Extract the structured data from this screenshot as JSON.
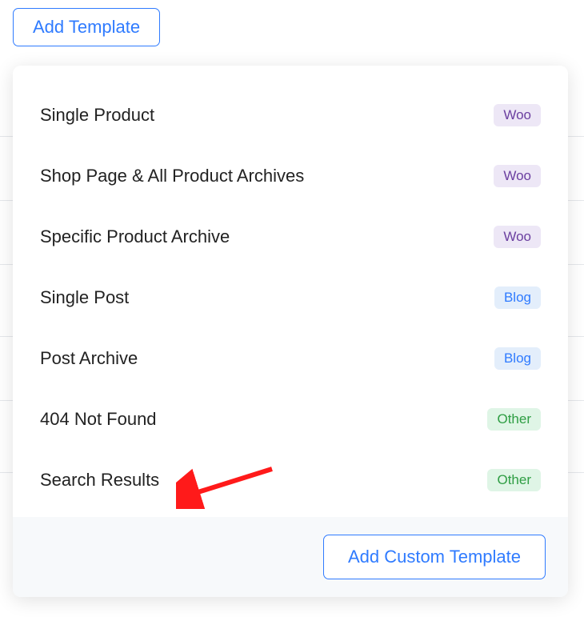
{
  "trigger": {
    "label": "Add Template"
  },
  "items": [
    {
      "label": "Single Product",
      "badge": "Woo",
      "badgeClass": "badge-woo"
    },
    {
      "label": "Shop Page & All Product Archives",
      "badge": "Woo",
      "badgeClass": "badge-woo"
    },
    {
      "label": "Specific Product Archive",
      "badge": "Woo",
      "badgeClass": "badge-woo"
    },
    {
      "label": "Single Post",
      "badge": "Blog",
      "badgeClass": "badge-blog"
    },
    {
      "label": "Post Archive",
      "badge": "Blog",
      "badgeClass": "badge-blog"
    },
    {
      "label": "404 Not Found",
      "badge": "Other",
      "badgeClass": "badge-other"
    },
    {
      "label": "Search Results",
      "badge": "Other",
      "badgeClass": "badge-other"
    }
  ],
  "footer": {
    "label": "Add Custom Template"
  }
}
